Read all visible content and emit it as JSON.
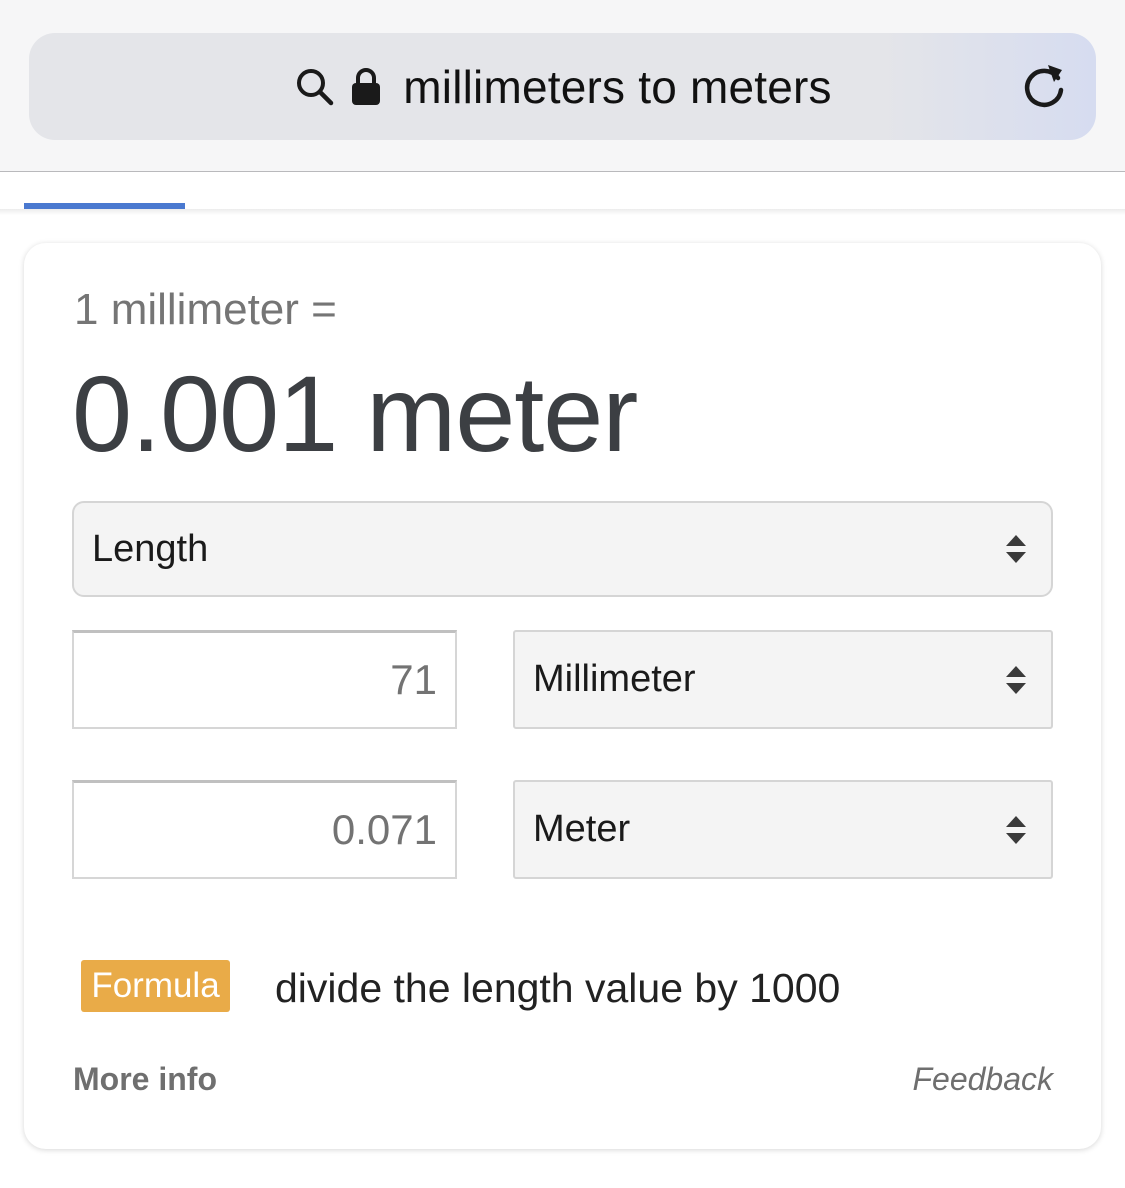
{
  "browser": {
    "address_text": "millimeters to meters",
    "icons": {
      "search": "search-icon",
      "lock": "lock-icon",
      "reload": "reload-icon"
    },
    "progress_indicator_color": "#4a79d0"
  },
  "converter": {
    "equation_text": "1 millimeter =",
    "result_text": "0.001 meter",
    "category": {
      "selected": "Length"
    },
    "from": {
      "value": "71",
      "unit": "Millimeter"
    },
    "to": {
      "value": "0.071",
      "unit": "Meter"
    },
    "formula": {
      "badge": "Formula",
      "text": "divide the length value by 1000",
      "badge_color": "#e9ab48"
    },
    "more_info_label": "More info",
    "feedback_label": "Feedback"
  }
}
